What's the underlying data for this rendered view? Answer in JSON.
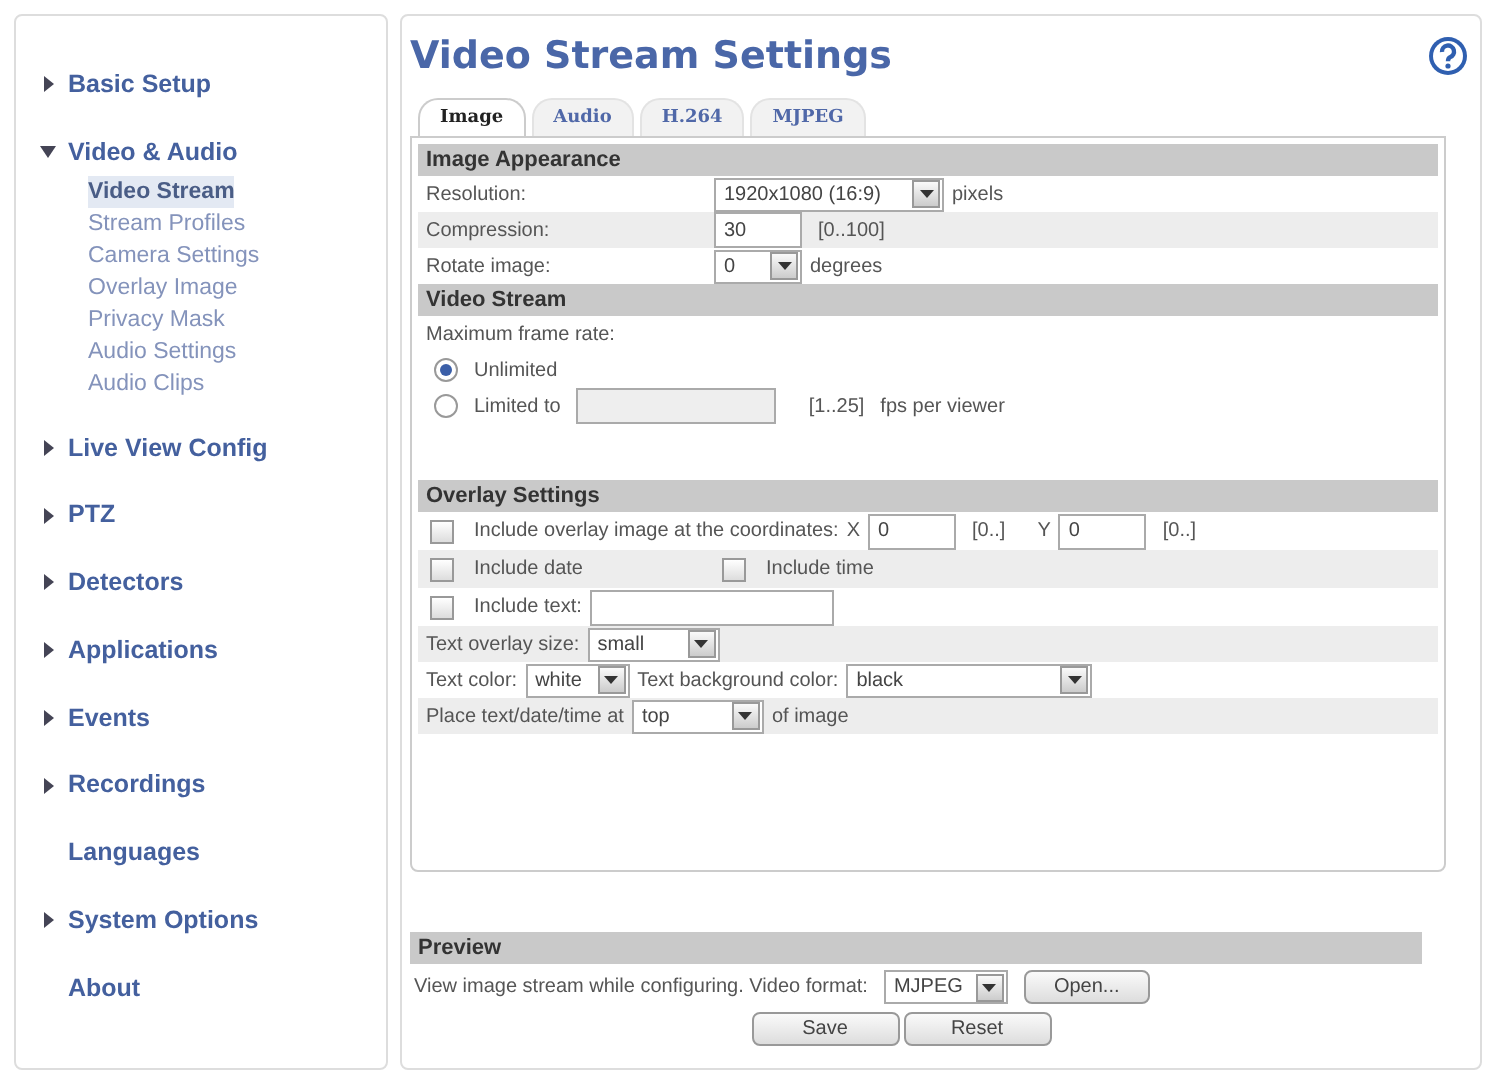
{
  "sidebar": {
    "items": [
      {
        "label": "Basic Setup",
        "expanded": false
      },
      {
        "label": "Video & Audio",
        "expanded": true,
        "children": [
          {
            "label": "Video Stream",
            "selected": true
          },
          {
            "label": "Stream Profiles",
            "selected": false
          },
          {
            "label": "Camera Settings",
            "selected": false
          },
          {
            "label": "Overlay Image",
            "selected": false
          },
          {
            "label": "Privacy Mask",
            "selected": false
          },
          {
            "label": "Audio Settings",
            "selected": false
          },
          {
            "label": "Audio Clips",
            "selected": false
          }
        ]
      },
      {
        "label": "Live View Config",
        "expanded": false
      },
      {
        "label": "PTZ",
        "expanded": false
      },
      {
        "label": "Detectors",
        "expanded": false
      },
      {
        "label": "Applications",
        "expanded": false
      },
      {
        "label": "Events",
        "expanded": false
      },
      {
        "label": "Recordings",
        "expanded": false
      },
      {
        "label": "Languages"
      },
      {
        "label": "System Options",
        "expanded": false
      },
      {
        "label": "About"
      }
    ]
  },
  "page_title": "Video Stream Settings",
  "tabs": [
    {
      "label": "Image",
      "selected": true
    },
    {
      "label": "Audio",
      "selected": false
    },
    {
      "label": "H.264",
      "selected": false
    },
    {
      "label": "MJPEG",
      "selected": false
    }
  ],
  "image_appearance": {
    "title": "Image Appearance",
    "resolution": {
      "label": "Resolution:",
      "value": "1920x1080 (16:9)",
      "unit": "pixels"
    },
    "compression": {
      "label": "Compression:",
      "value": "30",
      "range": "[0..100]"
    },
    "rotate": {
      "label": "Rotate image:",
      "value": "0",
      "unit": "degrees"
    }
  },
  "video_stream": {
    "title": "Video Stream",
    "frame_rate_label": "Maximum frame rate:",
    "options": [
      {
        "label": "Unlimited",
        "selected": true
      },
      {
        "label": "Limited to",
        "selected": false
      }
    ],
    "range": "[1..25]",
    "unit": "fps per viewer"
  },
  "overlay": {
    "title": "Overlay Settings",
    "overlay_image": {
      "label": "Include overlay image at the coordinates:",
      "checked": false,
      "x_label": "X",
      "x_value": "0",
      "x_range": "[0..]",
      "y_label": "Y",
      "y_value": "0",
      "y_range": "[0..]"
    },
    "include_date": {
      "label": "Include date",
      "checked": false
    },
    "include_time": {
      "label": "Include time",
      "checked": false
    },
    "include_text": {
      "label": "Include text:",
      "checked": false
    },
    "size": {
      "label": "Text overlay size:",
      "value": "small"
    },
    "text_color": {
      "label": "Text color:",
      "value": "white"
    },
    "bg_color": {
      "label": "Text background color:",
      "value": "black"
    },
    "position": {
      "label": "Place text/date/time at",
      "value": "top",
      "suffix": "of image"
    }
  },
  "preview": {
    "title": "Preview",
    "label": "View image stream while configuring. Video format:",
    "format": "MJPEG",
    "open_button": "Open..."
  },
  "buttons": [
    "Save",
    "Reset"
  ]
}
